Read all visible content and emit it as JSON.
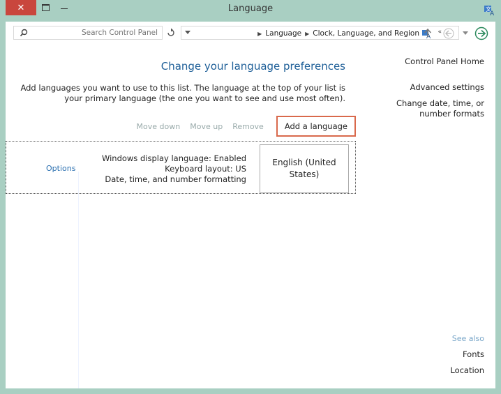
{
  "window": {
    "title": "Language",
    "close_glyph": "✕"
  },
  "search": {
    "placeholder": "Search Control Panel"
  },
  "address": {
    "overflow": "«",
    "crumbs": [
      "Clock, Language, and Region",
      "Language"
    ]
  },
  "sidebar": {
    "items": [
      {
        "label": "Control Panel Home"
      },
      {
        "label": "Advanced settings"
      },
      {
        "label": "Change date, time, or number formats"
      }
    ],
    "see_also_title": "See also",
    "see_also": [
      {
        "label": "Fonts"
      },
      {
        "label": "Location"
      }
    ]
  },
  "main": {
    "heading": "Change your language preferences",
    "description": "Add languages you want to use to this list. The language at the top of your list is your primary language (the one you want to see and use most often).",
    "toolbar": {
      "add": "Add a language",
      "remove": "Remove",
      "move_up": "Move up",
      "move_down": "Move down"
    },
    "languages": [
      {
        "name": "English (United States)",
        "details": [
          "Windows display language: Enabled",
          "Keyboard layout: US",
          "Date, time, and number formatting"
        ],
        "options": "Options"
      }
    ]
  },
  "colors": {
    "window_frame": "#a9cfc2",
    "close_button": "#c9463d",
    "heading": "#1e5f98",
    "highlight_box": "#d9694c",
    "link": "#2a6fb0"
  },
  "icons": [
    "close-icon",
    "maximize-icon",
    "minimize-icon",
    "app-icon",
    "search-icon",
    "refresh-icon",
    "dropdown-icon",
    "control-panel-icon",
    "up-arrow-icon",
    "history-dropdown-icon",
    "forward-arrow-icon",
    "back-arrow-icon"
  ]
}
